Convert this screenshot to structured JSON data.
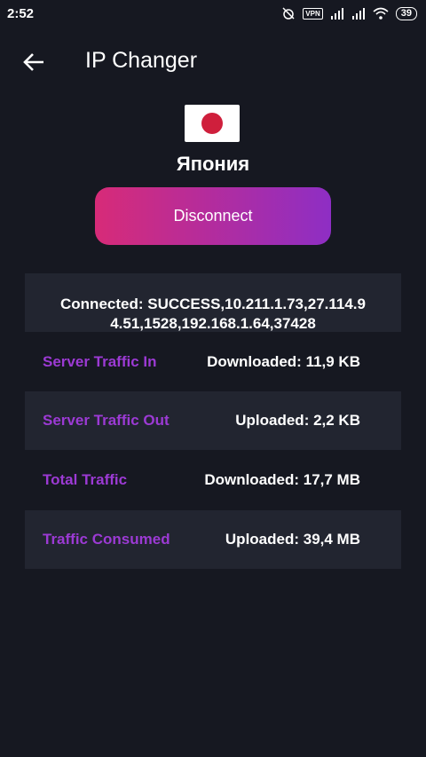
{
  "status_bar": {
    "time": "2:52",
    "vpn_label": "VPN",
    "battery": "39"
  },
  "app_bar": {
    "title": "IP Changer",
    "back_icon": "arrow-left-icon"
  },
  "server": {
    "country": "Япония",
    "flag": "japan-flag"
  },
  "disconnect_label": "Disconnect",
  "connection": {
    "line1": "Connected: SUCCESS,10.211.1.73,27.114.9",
    "line2": "4.51,1528,192.168.1.64,37428"
  },
  "stats": [
    {
      "label": "Server Traffic In",
      "value": "Downloaded: 11,9 KB"
    },
    {
      "label": "Server Traffic Out",
      "value": "Uploaded: 2,2 KB"
    },
    {
      "label": "Total Traffic",
      "value": "Downloaded: 17,7 MB"
    },
    {
      "label": "Traffic Consumed",
      "value": "Uploaded: 39,4 MB"
    }
  ],
  "colors": {
    "background": "#161821",
    "panel": "#222530",
    "accent_label": "#9c3ad4",
    "gradient_start": "#d72b78",
    "gradient_end": "#8e2ec4",
    "flag_red": "#cf1f3c"
  }
}
